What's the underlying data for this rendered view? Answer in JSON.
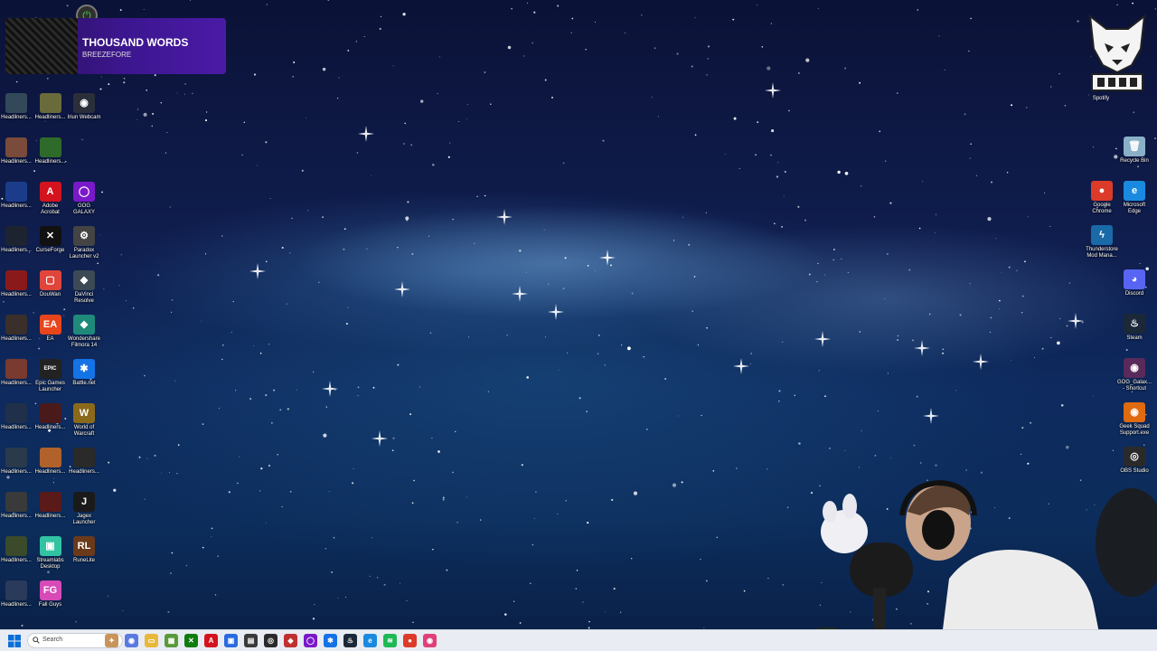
{
  "now_playing": {
    "title": "THOUSAND WORDS",
    "artist": "BREEZEFORE"
  },
  "glitch_label": "Spotify",
  "left_icons": [
    {
      "name": "Headliners...",
      "color": "#33495a",
      "glyph": "",
      "col": 0,
      "row": 0
    },
    {
      "name": "Headliners...",
      "color": "#6a6b3b",
      "glyph": "",
      "col": 1,
      "row": 0
    },
    {
      "name": "Iriun Webcam",
      "color": "#2a2f3a",
      "glyph": "◉",
      "col": 2,
      "row": 0
    },
    {
      "name": "Headliners...",
      "color": "#7a4a3a",
      "glyph": "",
      "col": 0,
      "row": 1
    },
    {
      "name": "Headliners...",
      "color": "#2e6b2a",
      "glyph": "",
      "col": 1,
      "row": 1
    },
    {
      "name": "Headliners...",
      "color": "#1b3c8a",
      "glyph": "",
      "col": 0,
      "row": 2
    },
    {
      "name": "Adobe Acrobat",
      "color": "#d3131d",
      "glyph": "A",
      "col": 1,
      "row": 2
    },
    {
      "name": "GOG GALAXY",
      "color": "#7a19c9",
      "glyph": "◯",
      "col": 2,
      "row": 2
    },
    {
      "name": "Headliners...",
      "color": "#1d2430",
      "glyph": "",
      "col": 0,
      "row": 3
    },
    {
      "name": "CurseForge",
      "color": "#111111",
      "glyph": "✕",
      "col": 1,
      "row": 3
    },
    {
      "name": "Paradox Launcher v2",
      "color": "#444444",
      "glyph": "⚙",
      "col": 2,
      "row": 3
    },
    {
      "name": "Headliners...",
      "color": "#8a1a1a",
      "glyph": "",
      "col": 0,
      "row": 4
    },
    {
      "name": "DouWan",
      "color": "#e0453b",
      "glyph": "▢",
      "col": 1,
      "row": 4
    },
    {
      "name": "DaVinci Resolve",
      "color": "#3b4a55",
      "glyph": "◆",
      "col": 2,
      "row": 4
    },
    {
      "name": "Headliners...",
      "color": "#3a2f2a",
      "glyph": "",
      "col": 0,
      "row": 5
    },
    {
      "name": "EA",
      "color": "#e8451c",
      "glyph": "EA",
      "col": 1,
      "row": 5
    },
    {
      "name": "Wondershare Filmora 14",
      "color": "#1f8a7a",
      "glyph": "◆",
      "col": 2,
      "row": 5
    },
    {
      "name": "Headliners...",
      "color": "#7a3a2f",
      "glyph": "",
      "col": 0,
      "row": 6
    },
    {
      "name": "Epic Games Launcher",
      "color": "#222222",
      "glyph": "EPIC",
      "col": 1,
      "row": 6
    },
    {
      "name": "Battle.net",
      "color": "#1473e6",
      "glyph": "✱",
      "col": 2,
      "row": 6
    },
    {
      "name": "Headliners...",
      "color": "#20304a",
      "glyph": "",
      "col": 0,
      "row": 7
    },
    {
      "name": "Headliners...",
      "color": "#4a1a1a",
      "glyph": "",
      "col": 1,
      "row": 7
    },
    {
      "name": "World of Warcraft",
      "color": "#8a6a1a",
      "glyph": "W",
      "col": 2,
      "row": 7
    },
    {
      "name": "Headliners...",
      "color": "#2a3a4a",
      "glyph": "",
      "col": 0,
      "row": 8
    },
    {
      "name": "Headliners...",
      "color": "#b0622a",
      "glyph": "",
      "col": 1,
      "row": 8
    },
    {
      "name": "Headliners...",
      "color": "#2a2a2a",
      "glyph": "",
      "col": 2,
      "row": 8
    },
    {
      "name": "Headliners...",
      "color": "#3a3a3a",
      "glyph": "",
      "col": 0,
      "row": 9
    },
    {
      "name": "Headliners...",
      "color": "#5a1a1a",
      "glyph": "",
      "col": 1,
      "row": 9
    },
    {
      "name": "Jagex Launcher",
      "color": "#1a1a1a",
      "glyph": "J",
      "col": 2,
      "row": 9
    },
    {
      "name": "Headliners...",
      "color": "#3a4a2a",
      "glyph": "",
      "col": 0,
      "row": 10
    },
    {
      "name": "Streamlabs Desktop",
      "color": "#31c3a2",
      "glyph": "▣",
      "col": 1,
      "row": 10
    },
    {
      "name": "RuneLite",
      "color": "#6a3a1a",
      "glyph": "RL",
      "col": 2,
      "row": 10
    },
    {
      "name": "Headliners...",
      "color": "#2a3a5a",
      "glyph": "",
      "col": 0,
      "row": 11
    },
    {
      "name": "Fall Guys",
      "color": "#d84ab8",
      "glyph": "FG",
      "col": 1,
      "row": 11
    }
  ],
  "right_icons": [
    {
      "name": "Recycle Bin",
      "color": "#8ab0c8",
      "glyph": "🗑",
      "col": 1,
      "row": 0
    },
    {
      "name": "Google Chrome",
      "color": "#dd3b2a",
      "glyph": "●",
      "col": 0,
      "row": 1
    },
    {
      "name": "Microsoft Edge",
      "color": "#1a8ae0",
      "glyph": "e",
      "col": 1,
      "row": 1
    },
    {
      "name": "Thunderstore Mod Mana...",
      "color": "#1a6aa8",
      "glyph": "ϟ",
      "col": 0,
      "row": 2
    },
    {
      "name": "Discord",
      "color": "#5865f2",
      "glyph": "◕",
      "col": 1,
      "row": 3
    },
    {
      "name": "Steam",
      "color": "#1b2838",
      "glyph": "♨",
      "col": 1,
      "row": 4
    },
    {
      "name": "GOG_Galax... - Shortcut",
      "color": "#5a2a5a",
      "glyph": "◉",
      "col": 1,
      "row": 5
    },
    {
      "name": "Geek Squad Support.exe",
      "color": "#e06a10",
      "glyph": "◉",
      "col": 1,
      "row": 6
    },
    {
      "name": "OBS Studio",
      "color": "#2a2a2a",
      "glyph": "◎",
      "col": 1,
      "row": 7
    }
  ],
  "taskbar": {
    "search_placeholder": "Search",
    "apps": [
      {
        "name": "taskbar-app-widget",
        "color": "#c9945a",
        "glyph": "✦"
      },
      {
        "name": "taskbar-app-copilot",
        "color": "#5a7ae0",
        "glyph": "◉"
      },
      {
        "name": "taskbar-app-file-explorer",
        "color": "#e8b83a",
        "glyph": "▭"
      },
      {
        "name": "taskbar-app-minecraft",
        "color": "#5a9a3a",
        "glyph": "▦"
      },
      {
        "name": "taskbar-app-xbox",
        "color": "#107c10",
        "glyph": "✕"
      },
      {
        "name": "taskbar-app-adobe",
        "color": "#d3131d",
        "glyph": "A"
      },
      {
        "name": "taskbar-app-store",
        "color": "#2a6ae0",
        "glyph": "▣"
      },
      {
        "name": "taskbar-app-terminal",
        "color": "#3a3a3a",
        "glyph": "▤"
      },
      {
        "name": "taskbar-app-obs",
        "color": "#2a2a2a",
        "glyph": "◎"
      },
      {
        "name": "taskbar-app-paradox",
        "color": "#c03030",
        "glyph": "◆"
      },
      {
        "name": "taskbar-app-gog",
        "color": "#7a19c9",
        "glyph": "◯"
      },
      {
        "name": "taskbar-app-battlenet",
        "color": "#1473e6",
        "glyph": "✱"
      },
      {
        "name": "taskbar-app-steam",
        "color": "#1b2838",
        "glyph": "♨"
      },
      {
        "name": "taskbar-app-edge",
        "color": "#1a8ae0",
        "glyph": "e"
      },
      {
        "name": "taskbar-app-spotify",
        "color": "#1db954",
        "glyph": "≋"
      },
      {
        "name": "taskbar-app-chrome",
        "color": "#dd3b2a",
        "glyph": "●"
      },
      {
        "name": "taskbar-app-streamlabs",
        "color": "#e0407a",
        "glyph": "◉"
      }
    ]
  }
}
